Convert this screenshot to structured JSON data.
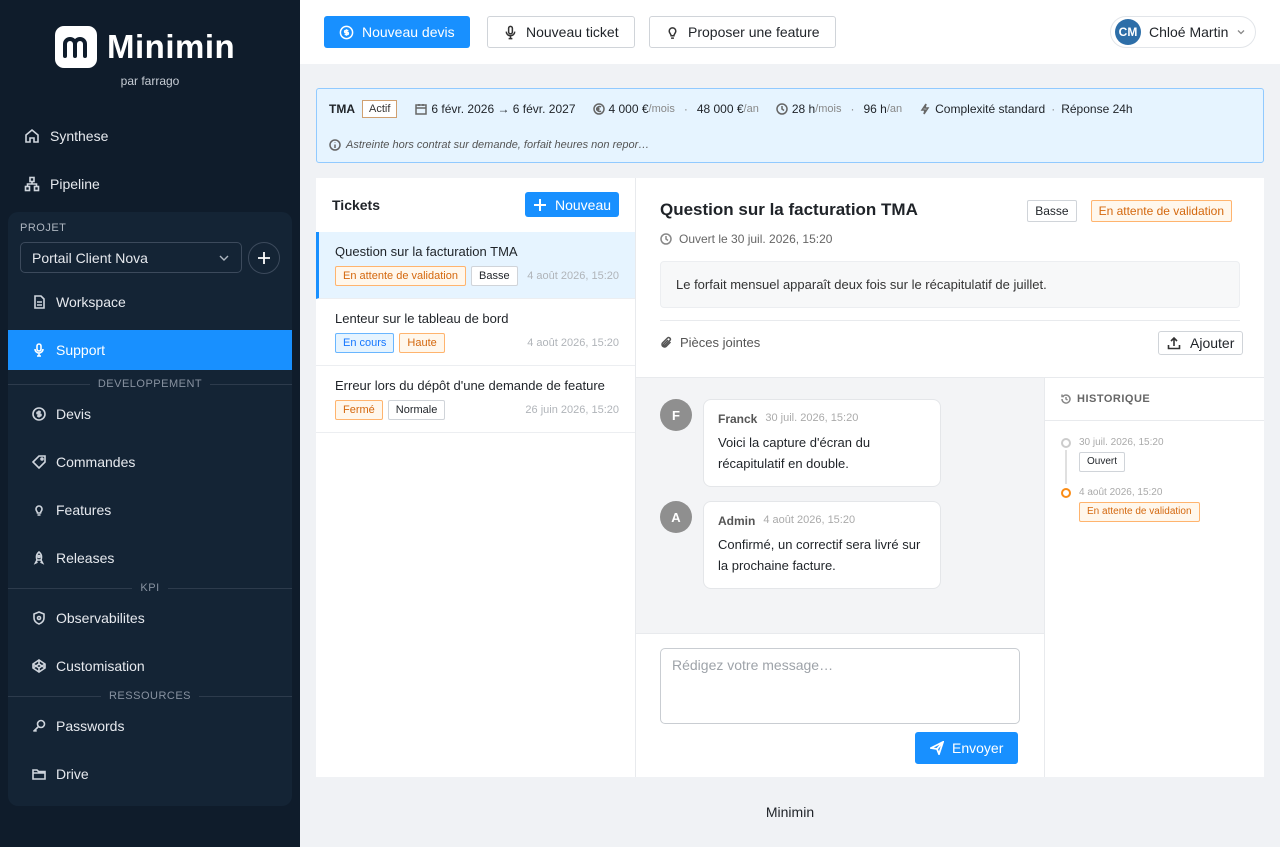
{
  "brand": {
    "name": "Minimin",
    "subtitle": "par farrago"
  },
  "nav": {
    "synthese": "Synthese",
    "pipeline": "Pipeline"
  },
  "project": {
    "section_label": "PROJET",
    "selected": "Portail Client Nova",
    "items": {
      "workspace": "Workspace",
      "support": "Support"
    },
    "dev_label": "DEVELOPPEMENT",
    "dev_items": {
      "devis": "Devis",
      "commandes": "Commandes",
      "features": "Features",
      "releases": "Releases"
    },
    "kpi_label": "KPI",
    "kpi_items": {
      "observabilites": "Observabilites",
      "customisation": "Customisation"
    },
    "res_label": "RESSOURCES",
    "res_items": {
      "passwords": "Passwords",
      "drive": "Drive"
    }
  },
  "topbar": {
    "new_quote": "Nouveau devis",
    "new_ticket": "Nouveau ticket",
    "propose_feature": "Proposer une feature",
    "user_initials": "CM",
    "user_name": "Chloé Martin"
  },
  "contract": {
    "type": "TMA",
    "status": "Actif",
    "period": "6 févr. 2026 → 6 févr. 2027",
    "monthly_price": "4 000 €",
    "monthly_unit": "/mois",
    "yearly_price": "48 000 €",
    "yearly_unit": "/an",
    "monthly_hours": "28 h",
    "monthly_hours_unit": "/mois",
    "yearly_hours": "96 h",
    "yearly_hours_unit": "/an",
    "complexity": "Complexité standard",
    "response": "Réponse 24h",
    "note": "Astreinte hors contrat sur demande, forfait heures non repor…"
  },
  "tickets": {
    "title": "Tickets",
    "new_label": "Nouveau",
    "items": [
      {
        "title": "Question sur la facturation TMA",
        "status": "En attente de validation",
        "priority": "Basse",
        "date": "4 août 2026, 15:20"
      },
      {
        "title": "Lenteur sur le tableau de bord",
        "status": "En cours",
        "priority": "Haute",
        "date": "4 août 2026, 15:20"
      },
      {
        "title": "Erreur lors du dépôt d'une demande de feature",
        "status": "Fermé",
        "priority": "Normale",
        "date": "26 juin 2026, 15:20"
      }
    ]
  },
  "detail": {
    "title": "Question sur la facturation TMA",
    "priority": "Basse",
    "status": "En attente de validation",
    "opened": "Ouvert le 30 juil. 2026, 15:20",
    "description": "Le forfait mensuel apparaît deux fois sur le récapitulatif de juillet.",
    "attachments_label": "Pièces jointes",
    "add_label": "Ajouter",
    "messages": [
      {
        "initial": "F",
        "author": "Franck",
        "date": "30 juil. 2026, 15:20",
        "text": "Voici la capture d'écran du récapitulatif en double."
      },
      {
        "initial": "A",
        "author": "Admin",
        "date": "4 août 2026, 15:20",
        "text": "Confirmé, un correctif sera livré sur la prochaine facture."
      }
    ],
    "composer_placeholder": "Rédigez votre message…",
    "send_label": "Envoyer"
  },
  "history": {
    "title": "HISTORIQUE",
    "events": [
      {
        "date": "30 juil. 2026, 15:20",
        "status": "Ouvert"
      },
      {
        "date": "4 août 2026, 15:20",
        "status": "En attente de validation"
      }
    ]
  },
  "footer": "Minimin",
  "colors": {
    "primary": "#1890ff",
    "sidebar": "#0f1c2b",
    "warning": "#fa8c16"
  }
}
